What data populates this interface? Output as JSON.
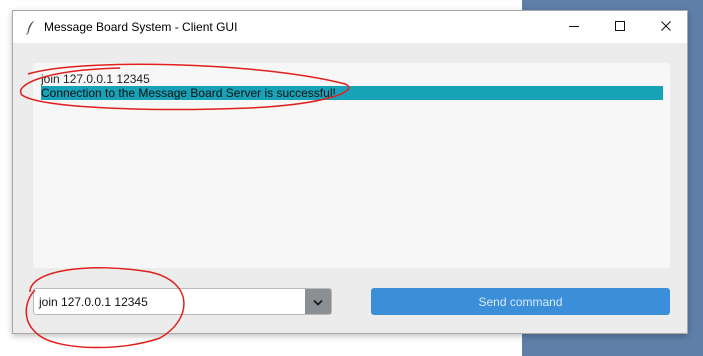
{
  "window": {
    "title": "Message Board System - Client GUI",
    "icon": "feather-icon",
    "controls": {
      "minimize": "minimize-icon",
      "maximize": "maximize-icon",
      "close": "close-icon"
    }
  },
  "log": {
    "lines": [
      {
        "text": "join 127.0.0.1 12345",
        "highlighted": false
      },
      {
        "text": "Connection to the Message Board Server is successful!",
        "highlighted": true
      }
    ]
  },
  "command": {
    "value": "join 127.0.0.1 12345",
    "dropdown_icon": "chevron-down-icon",
    "send_label": "Send command"
  },
  "colors": {
    "highlight": "#17a2b8",
    "send_button": "#3a8fd8",
    "annotation": "#e0201c"
  }
}
